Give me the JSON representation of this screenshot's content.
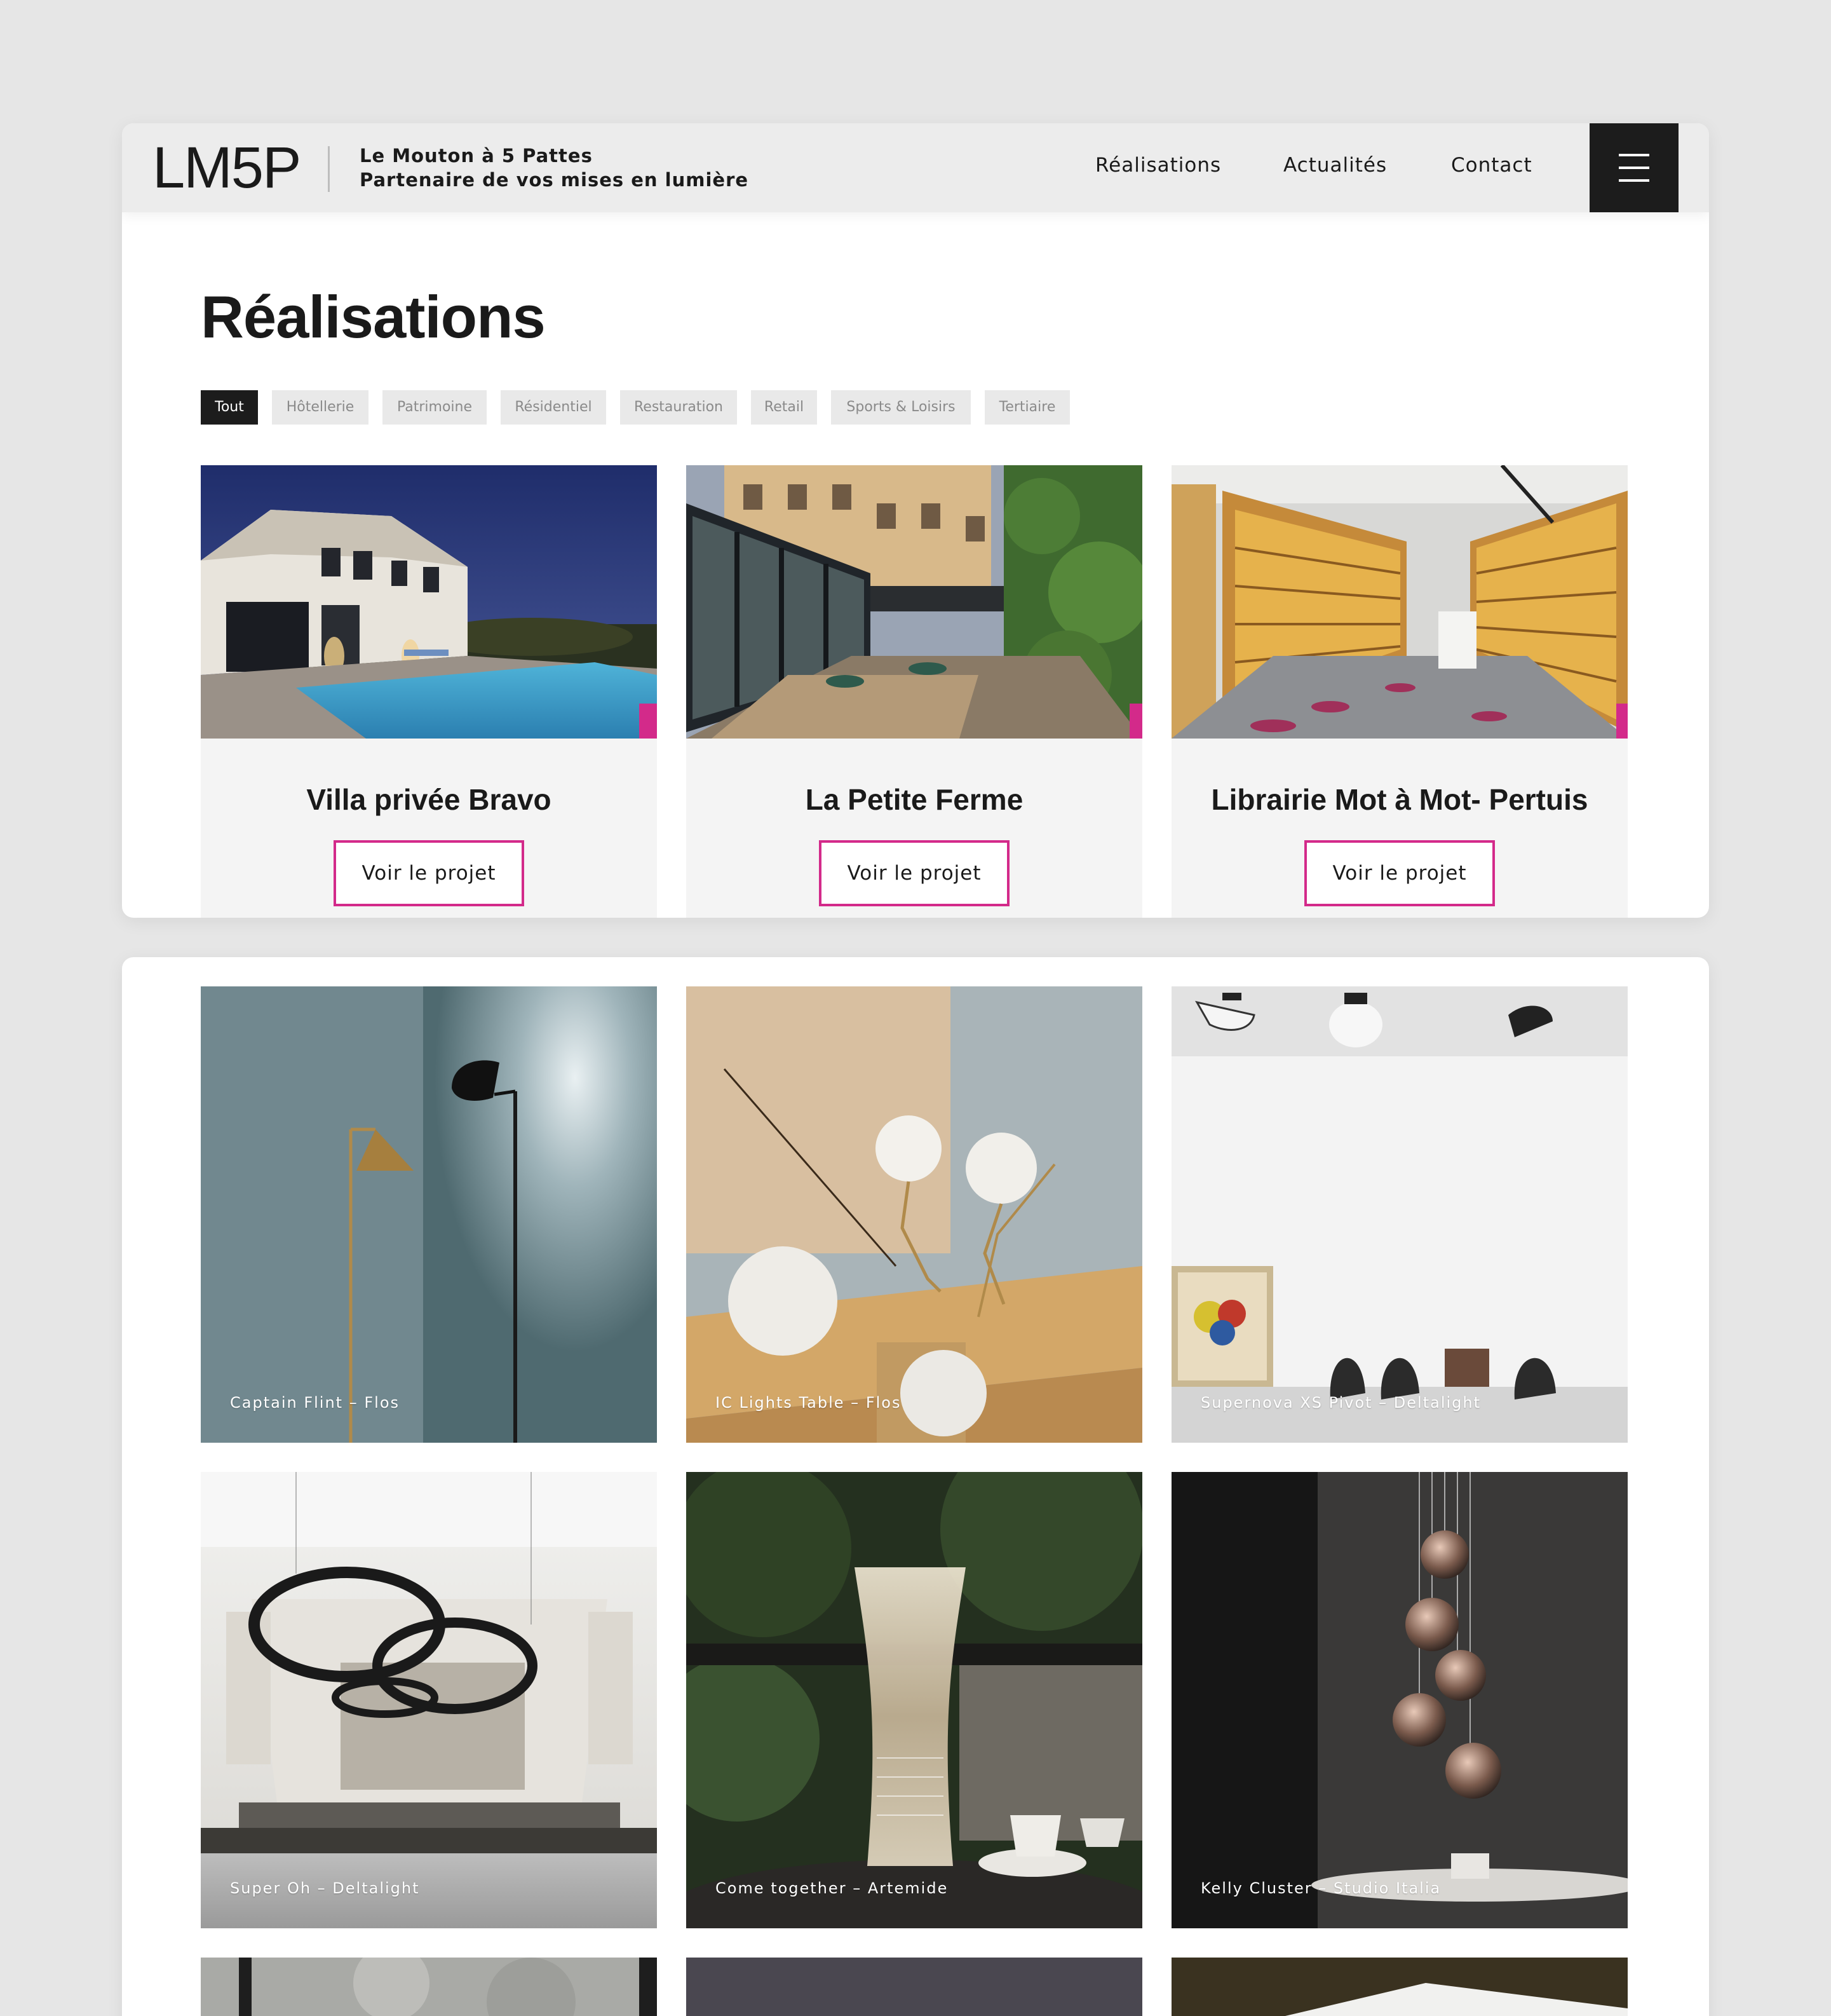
{
  "header": {
    "logo": "LM5P",
    "tagline_line1": "Le Mouton à 5 Pattes",
    "tagline_line2": "Partenaire de vos mises en lumière",
    "nav": [
      "Réalisations",
      "Actualités",
      "Contact"
    ],
    "menu_icon": "hamburger-icon"
  },
  "page": {
    "title": "Réalisations",
    "filters": [
      "Tout",
      "Hôtellerie",
      "Patrimoine",
      "Résidentiel",
      "Restauration",
      "Retail",
      "Sports & Loisirs",
      "Tertiaire"
    ],
    "active_filter": "Tout"
  },
  "projects": [
    {
      "title": "Villa privée Bravo",
      "button": "Voir le projet"
    },
    {
      "title": "La Petite Ferme",
      "button": "Voir le projet"
    },
    {
      "title": "Librairie Mot à Mot- Pertuis",
      "button": "Voir le projet"
    }
  ],
  "products": [
    {
      "caption": "Captain Flint – Flos"
    },
    {
      "caption": "IC Lights Table – Flos"
    },
    {
      "caption": "Supernova XS Pivot – Deltalight"
    },
    {
      "caption": "Super Oh – Deltalight"
    },
    {
      "caption": "Come together – Artemide"
    },
    {
      "caption": "Kelly Cluster – Studio Italia"
    }
  ],
  "colors": {
    "accent": "#d32a8a",
    "dark": "#1c1c1c",
    "background": "#e6e6e6"
  }
}
